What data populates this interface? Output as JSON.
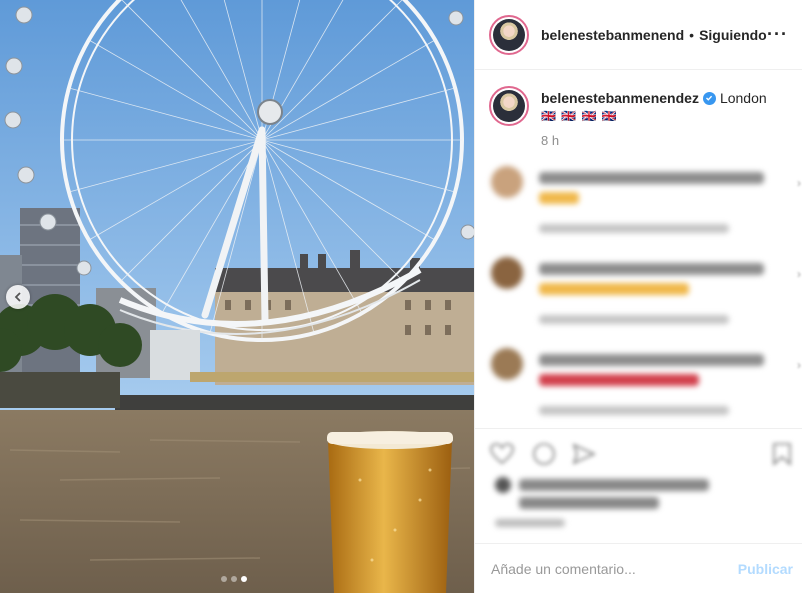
{
  "header": {
    "username": "belenesteban­menend",
    "separator": "•",
    "follow_status": "Siguiendo",
    "more": "···"
  },
  "caption": {
    "username": "belenestebanmenendez",
    "location": "London",
    "flags": "🇬🇧 🇬🇧 🇬🇧 🇬🇧",
    "time": "8 h"
  },
  "comment_box": {
    "placeholder": "Añade un comentario...",
    "post_label": "Publicar"
  },
  "carousel": {
    "slide_count": 3,
    "active_slide": 3
  },
  "colors": {
    "accent_blue": "#3897f0",
    "post_disabled": "#b3dbff",
    "story_ring": "#e0688f"
  }
}
